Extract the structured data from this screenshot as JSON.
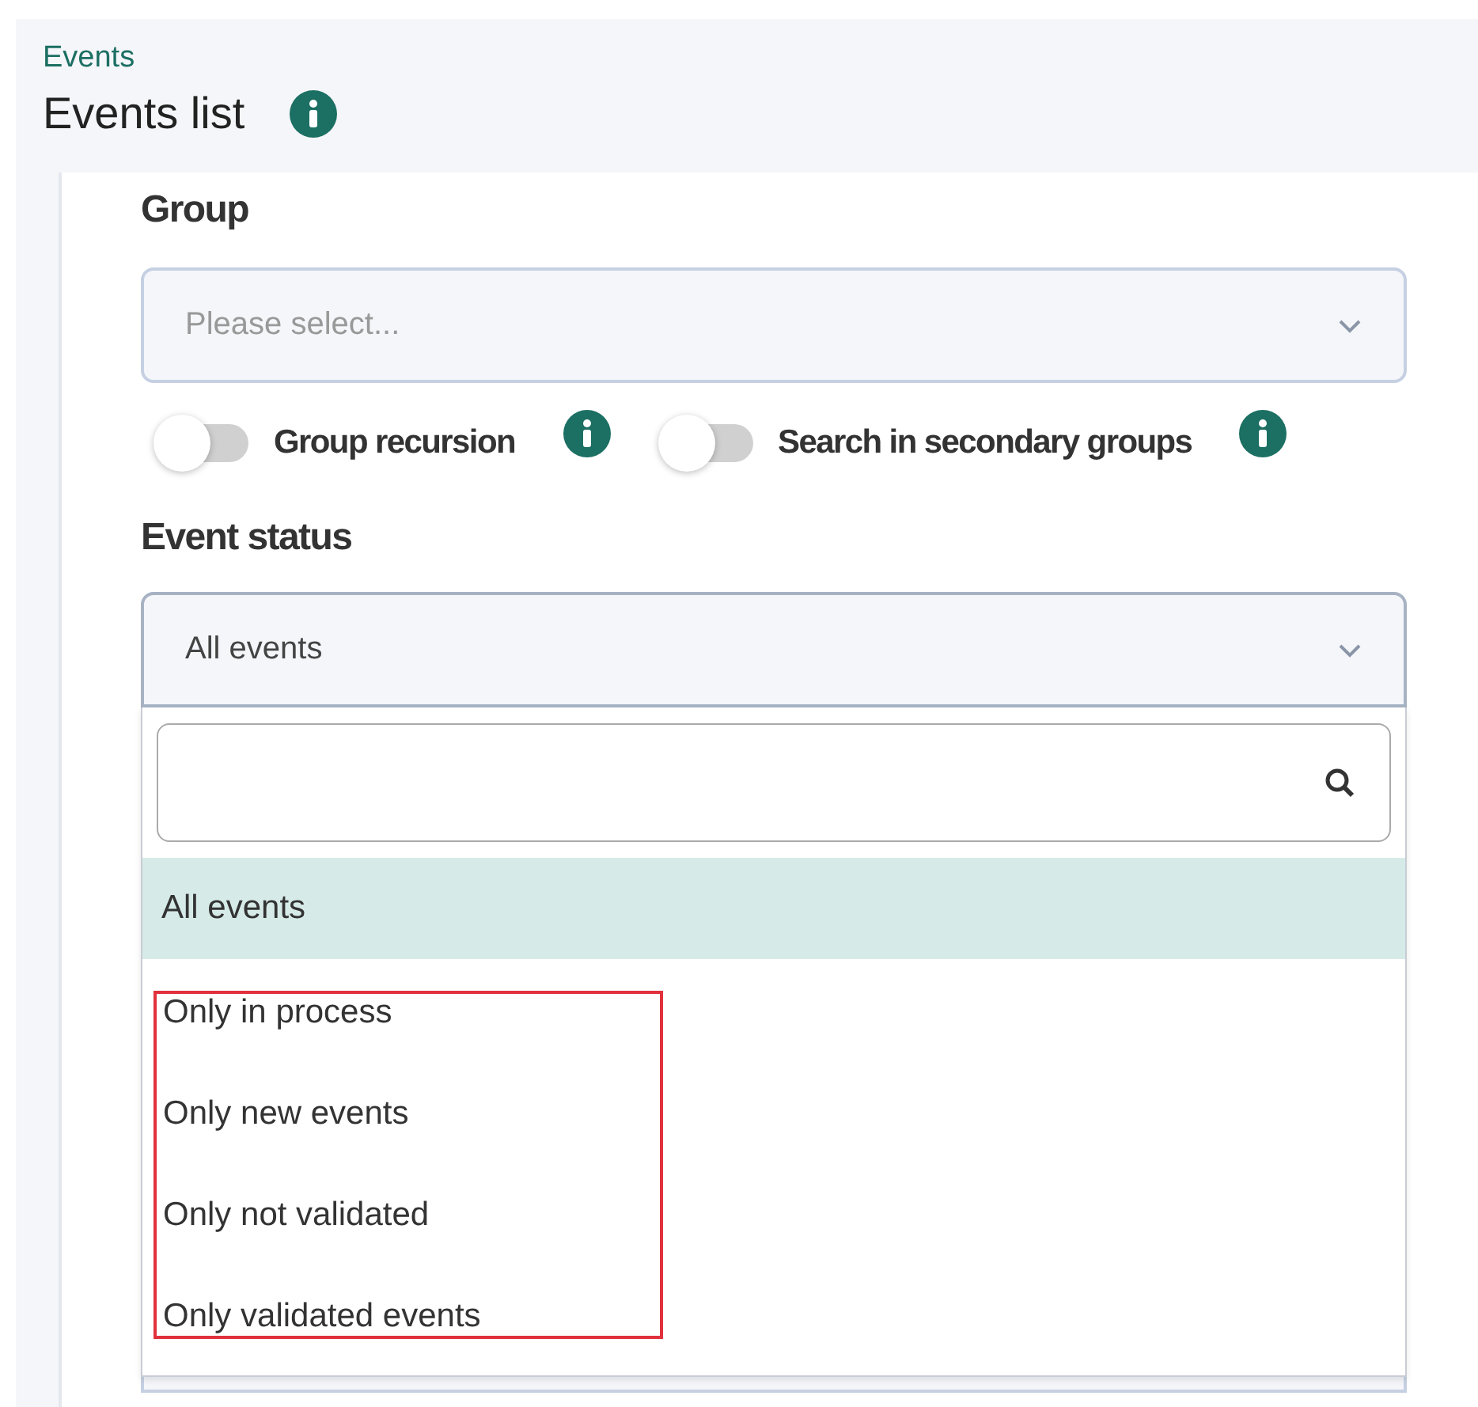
{
  "breadcrumb": "Events",
  "title": "Events list",
  "group_field": {
    "label": "Group",
    "placeholder": "Please select..."
  },
  "toggles": [
    {
      "label": "Group recursion",
      "on": false
    },
    {
      "label": "Search in secondary groups",
      "on": false
    }
  ],
  "status_field": {
    "label": "Event status",
    "value": "All events",
    "expanded": true,
    "options": [
      {
        "label": "All events",
        "selected": true,
        "highlighted": false
      },
      {
        "label": "Only in process",
        "selected": false,
        "highlighted": true
      },
      {
        "label": "Only new events",
        "selected": false,
        "highlighted": true
      },
      {
        "label": "Only not validated",
        "selected": false,
        "highlighted": true
      },
      {
        "label": "Only validated events",
        "selected": false,
        "highlighted": true
      }
    ]
  }
}
